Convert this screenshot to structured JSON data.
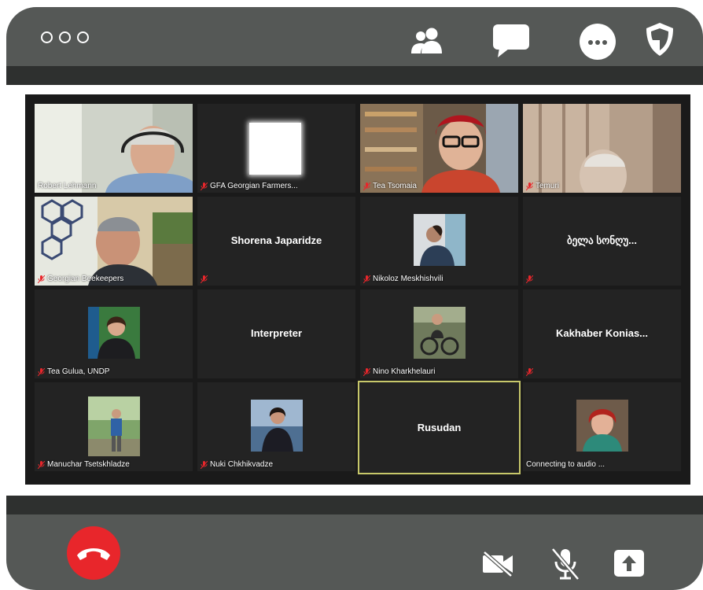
{
  "window": {
    "title_dots": [
      "dot-1",
      "dot-2",
      "dot-3"
    ]
  },
  "toolbar": {
    "icons": [
      "participants-icon",
      "chat-icon",
      "more-icon",
      "security-icon"
    ]
  },
  "participants": [
    {
      "name": "Robert Lehmann",
      "muted": false,
      "view": "video"
    },
    {
      "name": "GFA Georgian Farmers...",
      "muted": true,
      "view": "logo"
    },
    {
      "name": "Tea Tsomaia",
      "muted": true,
      "view": "video"
    },
    {
      "name": "Temuri",
      "muted": true,
      "view": "video"
    },
    {
      "name": "Georgian Beekeepers",
      "muted": true,
      "view": "video"
    },
    {
      "name": "Shorena Japaridze",
      "muted": true,
      "view": "name"
    },
    {
      "name": "Nikoloz Meskhishvili",
      "muted": true,
      "view": "photo"
    },
    {
      "name": "ბელა სონღუ...",
      "muted": true,
      "view": "name"
    },
    {
      "name": "Tea Gulua, UNDP",
      "muted": true,
      "view": "photo"
    },
    {
      "name": "Interpreter",
      "muted": false,
      "view": "name"
    },
    {
      "name": "Nino Kharkhelauri",
      "muted": true,
      "view": "photo"
    },
    {
      "name": "Kakhaber  Konias...",
      "muted": true,
      "view": "name"
    },
    {
      "name": "Manuchar Tsetskhladze",
      "muted": true,
      "view": "photo"
    },
    {
      "name": "Nuki Chkhikvadze",
      "muted": true,
      "view": "photo"
    },
    {
      "name": "Rusudan",
      "muted": false,
      "view": "name",
      "active": true
    },
    {
      "name": "Connecting to audio ...",
      "muted": false,
      "view": "photo"
    }
  ],
  "controls": {
    "icons": [
      "end-call-icon",
      "video-off-icon",
      "mic-off-icon",
      "share-screen-icon"
    ]
  },
  "colors": {
    "bar": "#555856",
    "strip": "#2e302f",
    "end_call": "#e8262b",
    "active_border": "#c7c86a"
  }
}
